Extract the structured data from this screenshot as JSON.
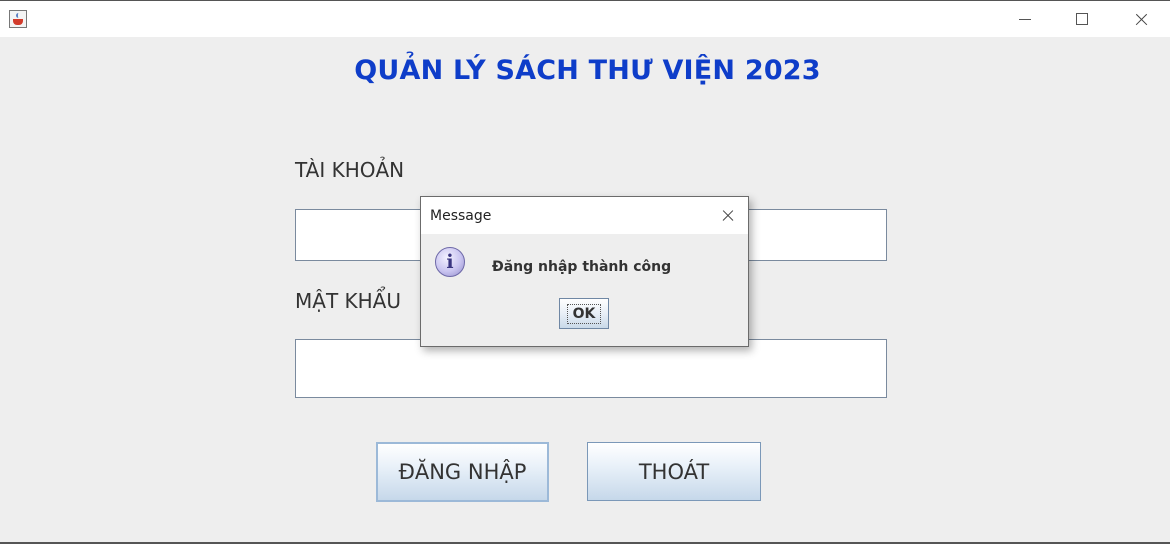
{
  "window": {
    "icon": "java-cup-icon",
    "controls": [
      "minimize-icon",
      "maximize-icon",
      "close-icon"
    ]
  },
  "main": {
    "title": "QUẢN LÝ SÁCH THƯ VIỆN 2023",
    "username_label": "TÀI KHOẢN",
    "username_value": "",
    "password_label": "MẬT KHẨU",
    "password_value": "",
    "login_button": "ĐĂNG NHẬP",
    "exit_button": "THOÁT"
  },
  "dialog": {
    "title": "Message",
    "icon": "info-icon",
    "message": "Đăng nhập thành công",
    "ok_button": "OK"
  },
  "colors": {
    "title_blue": "#0e3dc9",
    "background": "#eeeeee"
  }
}
